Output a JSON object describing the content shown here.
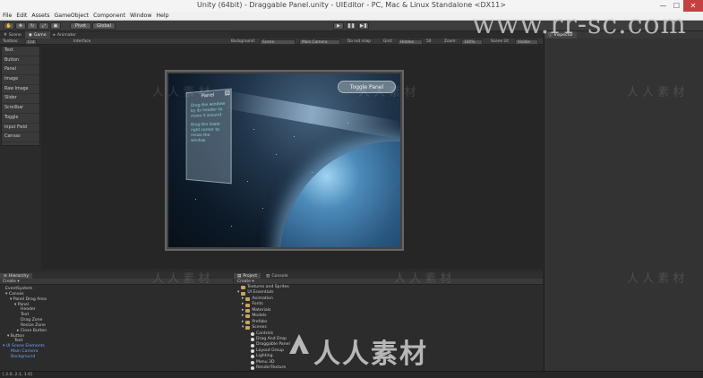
{
  "window": {
    "title": "Unity (64bit) - Draggable Panel.unity - UIEditor - PC, Mac & Linux Standalone <DX11>",
    "minimize": "—",
    "maximize": "☐",
    "close": "✕"
  },
  "menu": [
    "File",
    "Edit",
    "Assets",
    "GameObject",
    "Component",
    "Window",
    "Help"
  ],
  "toolbar": {
    "pivot": "Pivot",
    "global": "Global",
    "play": "▶",
    "pause": "❚❚",
    "step": "▶❚"
  },
  "tabs": {
    "scene": "Scene",
    "game": "Game",
    "animator": "Animator",
    "inspector": "Inspector",
    "hierarchy": "Hierarchy",
    "project": "Project",
    "console": "Console"
  },
  "game_bar": {
    "toolbox_label": "Toolbox:",
    "toolbox_value": "Cnt",
    "interface": "Interface",
    "background_label": "Background:",
    "background_value": "Scene",
    "camera_value": "Main Camera",
    "donotsnap": "Do not snap",
    "grid_label": "Grid:",
    "grid_value": "Hidden",
    "grid_size": "50",
    "zoom_label": "Zoom:",
    "zoom_value": "100%",
    "scene_ui_label": "Scene UI:",
    "scene_ui_value": "Visible"
  },
  "toolbox_items": [
    "Text",
    "Button",
    "Panel",
    "Image",
    "Raw Image",
    "Slider",
    "Scrollbar",
    "Toggle",
    "Input Field",
    "Canvas"
  ],
  "game_view": {
    "panel_title": "Panel",
    "panel_text_1": "Drag the window by its header to move it around",
    "panel_text_2": "Drag the lower right corner to resize the window",
    "panel_close": "x",
    "toggle_button": "Toggle Panel"
  },
  "hierarchy": {
    "create": "Create ▾",
    "items": [
      {
        "label": "EventSystem",
        "indent": 0,
        "blue": false
      },
      {
        "label": "▾ Canvas",
        "indent": 0,
        "blue": false
      },
      {
        "label": "▾ Panel Drag Area",
        "indent": 1,
        "blue": false
      },
      {
        "label": "▾ Panel",
        "indent": 2,
        "blue": false
      },
      {
        "label": "Header",
        "indent": 3,
        "blue": false
      },
      {
        "label": "Text",
        "indent": 3,
        "blue": false
      },
      {
        "label": "Drag Zone",
        "indent": 3,
        "blue": false
      },
      {
        "label": "Resize Zone",
        "indent": 3,
        "blue": false
      },
      {
        "label": "▸ Close Button",
        "indent": 3,
        "blue": false
      },
      {
        "label": "▾ Button",
        "indent": 1,
        "blue": false
      },
      {
        "label": "Text",
        "indent": 2,
        "blue": false
      },
      {
        "label": "▾ UI Scene Elements",
        "indent": 0,
        "blue": true
      },
      {
        "label": "Main Camera",
        "indent": 1,
        "blue": true
      },
      {
        "label": "Background",
        "indent": 1,
        "blue": true
      }
    ]
  },
  "project": {
    "create": "Create ▾",
    "items": [
      {
        "label": "Textures and Sprites",
        "indent": 0,
        "kind": "folder"
      },
      {
        "label": "UI Essentials",
        "indent": 0,
        "kind": "folder"
      },
      {
        "label": "Animation",
        "indent": 1,
        "kind": "folder"
      },
      {
        "label": "Fonts",
        "indent": 1,
        "kind": "folder"
      },
      {
        "label": "Materials",
        "indent": 1,
        "kind": "folder"
      },
      {
        "label": "Models",
        "indent": 1,
        "kind": "folder"
      },
      {
        "label": "Prefabs",
        "indent": 1,
        "kind": "folder"
      },
      {
        "label": "Scenes",
        "indent": 1,
        "kind": "folder"
      },
      {
        "label": "Controls",
        "indent": 2,
        "kind": "scene"
      },
      {
        "label": "Drag And Drop",
        "indent": 2,
        "kind": "scene"
      },
      {
        "label": "Draggable Panel",
        "indent": 2,
        "kind": "scene"
      },
      {
        "label": "Layout Group",
        "indent": 2,
        "kind": "scene"
      },
      {
        "label": "Lighting",
        "indent": 2,
        "kind": "scene"
      },
      {
        "label": "Menu 3D",
        "indent": 2,
        "kind": "scene"
      },
      {
        "label": "RenderTexture",
        "indent": 2,
        "kind": "scene"
      }
    ]
  },
  "status": "[ 2.0, 2.1, 1.0]",
  "watermarks": {
    "site": "www.rr-sc.com",
    "brand_cn": "人人素材",
    "repeat": "人 人 素 材"
  },
  "colors": {
    "editor_bg": "#2b2b2b",
    "close_red": "#c74040",
    "hierarchy_blue": "#6fa4ff",
    "panel_text": "#8ed7d0"
  }
}
